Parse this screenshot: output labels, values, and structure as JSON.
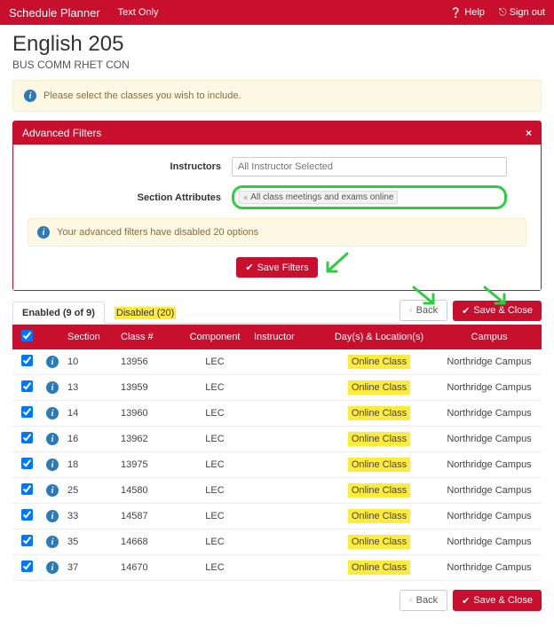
{
  "topbar": {
    "brand": "Schedule Planner",
    "textOnly": "Text Only",
    "help": "Help",
    "signOut": "Sign out"
  },
  "course": {
    "title": "English 205",
    "subtitle": "BUS COMM RHET CON"
  },
  "selectAlert": "Please select the classes you wish to include.",
  "filters": {
    "panelTitle": "Advanced Filters",
    "instructorsLabel": "Instructors",
    "instructorsPlaceholder": "All Instructor Selected",
    "attributesLabel": "Section Attributes",
    "attributeTag": "All class meetings and exams online",
    "disabledAlert": "Your advanced filters have disabled 20 options",
    "saveBtn": "Save Filters"
  },
  "tabs": {
    "enabled": "Enabled (9 of 9)",
    "disabled": "Disabled (20)"
  },
  "actions": {
    "back": "Back",
    "saveClose": "Save & Close"
  },
  "table": {
    "headers": {
      "section": "Section",
      "classNum": "Class #",
      "component": "Component",
      "instructor": "Instructor",
      "days": "Day(s) & Location(s)",
      "campus": "Campus"
    },
    "rows": [
      {
        "section": "10",
        "classNum": "13956",
        "component": "LEC",
        "instructor": "",
        "days": "Online Class",
        "campus": "Northridge Campus"
      },
      {
        "section": "13",
        "classNum": "13959",
        "component": "LEC",
        "instructor": "",
        "days": "Online Class",
        "campus": "Northridge Campus"
      },
      {
        "section": "14",
        "classNum": "13960",
        "component": "LEC",
        "instructor": "",
        "days": "Online Class",
        "campus": "Northridge Campus"
      },
      {
        "section": "16",
        "classNum": "13962",
        "component": "LEC",
        "instructor": "",
        "days": "Online Class",
        "campus": "Northridge Campus"
      },
      {
        "section": "18",
        "classNum": "13975",
        "component": "LEC",
        "instructor": "",
        "days": "Online Class",
        "campus": "Northridge Campus"
      },
      {
        "section": "25",
        "classNum": "14580",
        "component": "LEC",
        "instructor": "",
        "days": "Online Class",
        "campus": "Northridge Campus"
      },
      {
        "section": "33",
        "classNum": "14587",
        "component": "LEC",
        "instructor": "",
        "days": "Online Class",
        "campus": "Northridge Campus"
      },
      {
        "section": "35",
        "classNum": "14668",
        "component": "LEC",
        "instructor": "",
        "days": "Online Class",
        "campus": "Northridge Campus"
      },
      {
        "section": "37",
        "classNum": "14670",
        "component": "LEC",
        "instructor": "",
        "days": "Online Class",
        "campus": "Northridge Campus"
      }
    ]
  }
}
